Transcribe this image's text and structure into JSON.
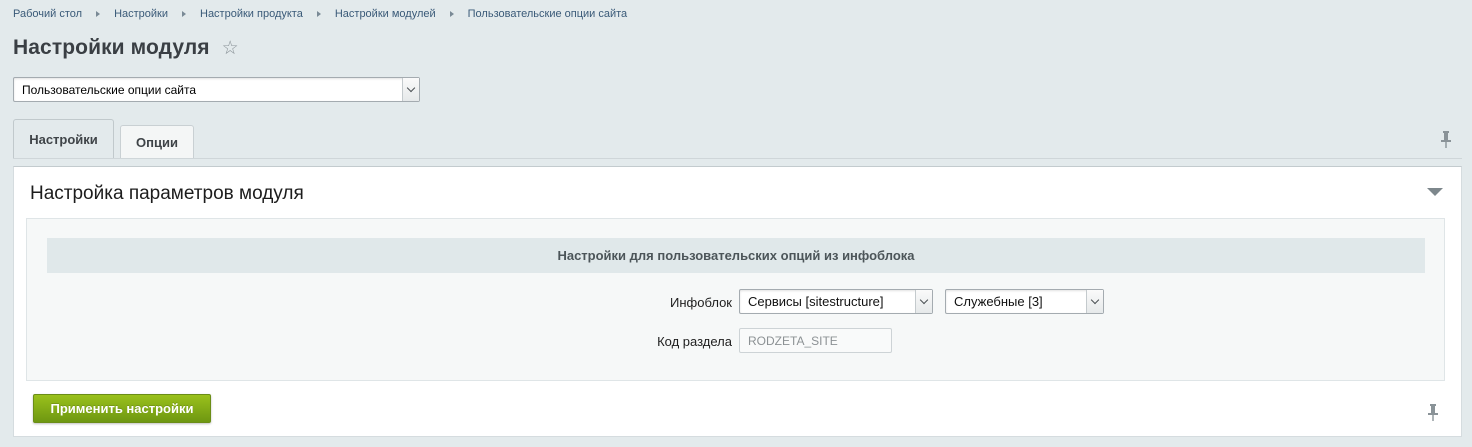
{
  "breadcrumb": [
    "Рабочий стол",
    "Настройки",
    "Настройки продукта",
    "Настройки модулей",
    "Пользовательские опции сайта"
  ],
  "page_title": "Настройки модуля",
  "module_select": {
    "value": "Пользовательские опции сайта"
  },
  "tabs": [
    {
      "label": "Настройки",
      "active": true
    },
    {
      "label": "Опции",
      "active": false
    }
  ],
  "panel": {
    "title": "Настройка параметров модуля",
    "section_header": "Настройки для пользовательских опций из инфоблока",
    "iblock_label": "Инфоблок",
    "iblock_type_value": "Сервисы [sitestructure]",
    "iblock_value": "Служебные [3]",
    "section_code_label": "Код раздела",
    "section_code_value": "RODZETA_SITE"
  },
  "apply_button": "Применить настройки",
  "colors": {
    "accent_green": "#8cb41a",
    "background": "#e3eaec",
    "link": "#3a5a78"
  },
  "icons": [
    "star-icon",
    "pin-icon",
    "chevron-down-icon",
    "collapse-arrow-icon"
  ]
}
